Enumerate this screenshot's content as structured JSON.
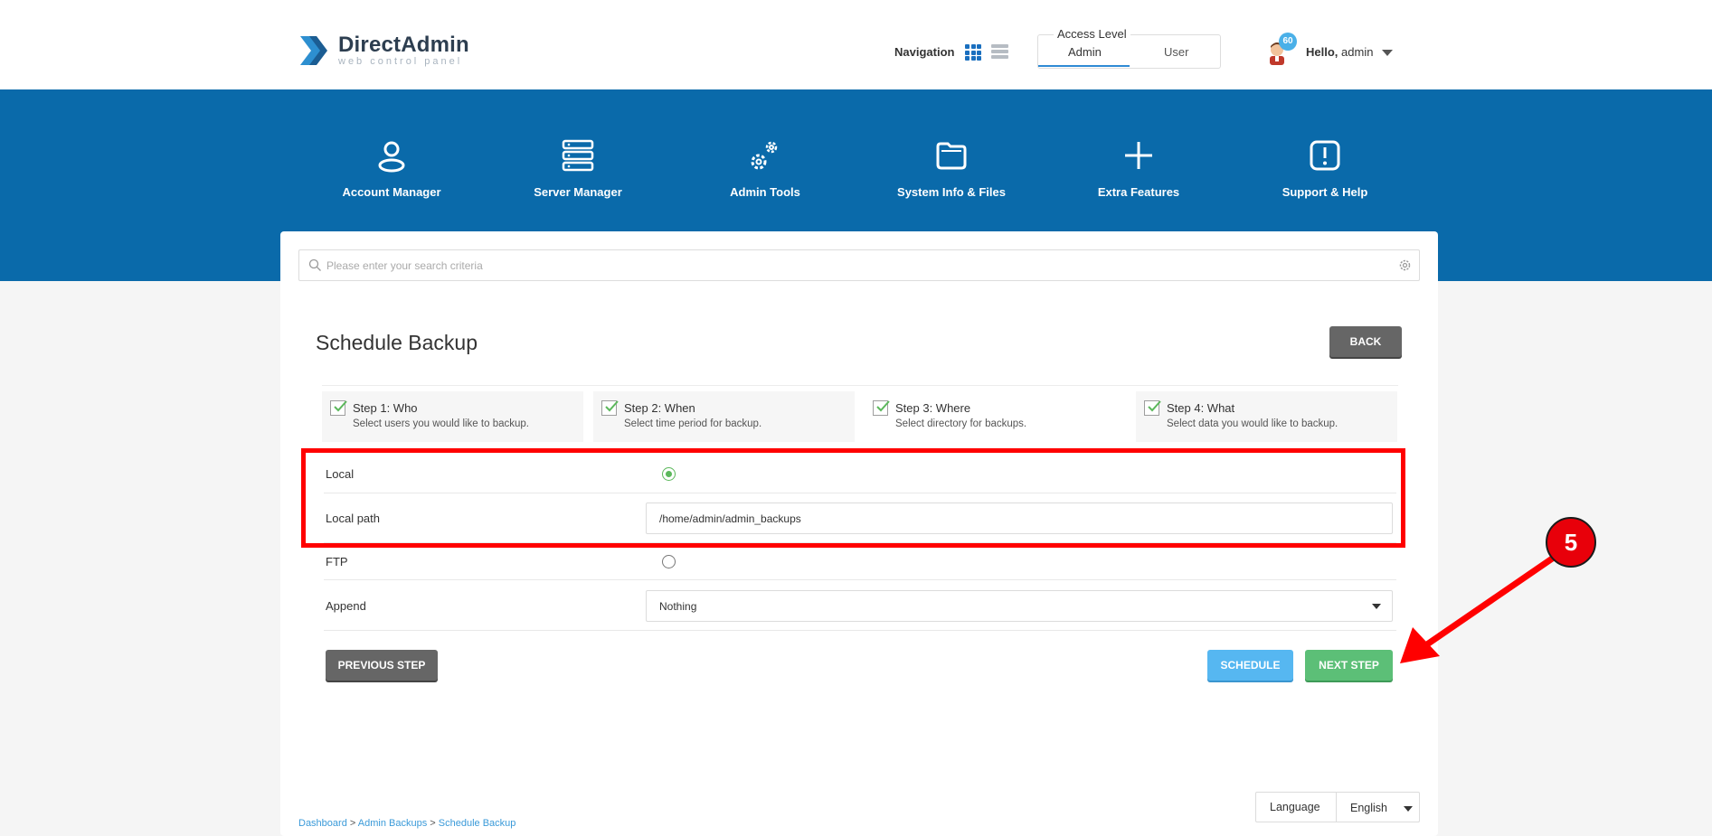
{
  "header": {
    "logo_title": "DirectAdmin",
    "logo_subtitle": "web control panel",
    "navigation_label": "Navigation",
    "access_level_title": "Access Level",
    "access_tabs": [
      "Admin",
      "User"
    ],
    "notification_count": "60",
    "greeting": "Hello,",
    "username": "admin"
  },
  "menu": [
    {
      "label": "Account Manager",
      "icon": "user-icon"
    },
    {
      "label": "Server Manager",
      "icon": "server-icon"
    },
    {
      "label": "Admin Tools",
      "icon": "gears-icon"
    },
    {
      "label": "System Info & Files",
      "icon": "folder-icon"
    },
    {
      "label": "Extra Features",
      "icon": "plus-icon"
    },
    {
      "label": "Support & Help",
      "icon": "exclamation-icon"
    }
  ],
  "search": {
    "placeholder": "Please enter your search criteria"
  },
  "page": {
    "title": "Schedule Backup",
    "back_label": "BACK"
  },
  "steps": [
    {
      "title": "Step 1: Who",
      "desc": "Select users you would like to backup."
    },
    {
      "title": "Step 2: When",
      "desc": "Select time period for backup."
    },
    {
      "title": "Step 3: Where",
      "desc": "Select directory for backups."
    },
    {
      "title": "Step 4: What",
      "desc": "Select data you would like to backup."
    }
  ],
  "form": {
    "local_label": "Local",
    "local_path_label": "Local path",
    "local_path_value": "/home/admin/admin_backups",
    "ftp_label": "FTP",
    "append_label": "Append",
    "append_value": "Nothing"
  },
  "actions": {
    "previous_label": "PREVIOUS STEP",
    "schedule_label": "SCHEDULE",
    "next_label": "NEXT STEP"
  },
  "annotation": {
    "number": "5",
    "color": "#e8000a"
  },
  "footer": {
    "language_label": "Language",
    "language_value": "English",
    "breadcrumbs": [
      "Dashboard",
      "Admin Backups",
      "Schedule Backup"
    ]
  },
  "colors": {
    "accent_blue": "#0a6aaa",
    "success_green": "#5cbf77",
    "info_blue": "#56b7f1",
    "highlight_red": "#ff0000"
  }
}
